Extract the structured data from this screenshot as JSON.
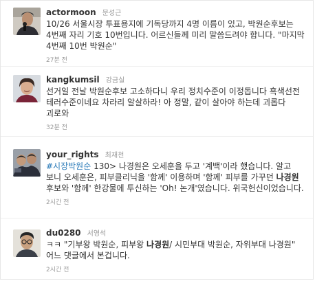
{
  "tweets": [
    {
      "screen_name": "actormoon",
      "full_name": "문성근",
      "text": "10/26 서울시장 투표용지에 기독당까지 4명 이름이 있고, 박원순후보는 4번째 자리 기호 10번입니다. 어르신들께 미리 말씀드려야 합니다. \"마지막 4번째 10번 박원순\"",
      "time": "27분 전",
      "avatar_icon": "man-microphone-avatar"
    },
    {
      "screen_name": "kangkumsil",
      "full_name": "강금실",
      "text": "선거일 전날 박원순후보 고소하다니 우리 정치수준이 이정돕니다 흑색선전 테러수준이네요 차라리 알살하라! 아 정말, 같이 살아야 하는데 괴롭다 괴로와",
      "time": "32분 전",
      "avatar_icon": "woman-smiling-avatar"
    },
    {
      "screen_name": "your_rights",
      "full_name": "최재천",
      "hashtag": "#시장박원순",
      "text_a": " 130> 나경원은 오세훈을 두고 '계백'이라 했습니다. 알고 보니 오세훈은, 피부클리닉을 '함께' 이용하며 '함께' 피부를 가꾸던 ",
      "bold": "나경원",
      "text_b": " 후보와 '함께' 한강물에 투신하는 'Oh! 논개'였습니다. 위국헌신이었습니다.",
      "time": "2시간 전",
      "avatar_icon": "group-photo-avatar"
    },
    {
      "screen_name": "du0280",
      "full_name": "서영석",
      "text_a": "ㅋㅋ \"기부왕 박원순, 피부왕 ",
      "bold": "나경원",
      "text_b": "/ 시민부대 박원순, 자위부대 나경원\" 어느 댓글에서 본겁니다.",
      "time": "2시간 전",
      "avatar_icon": "man-glasses-avatar"
    }
  ]
}
